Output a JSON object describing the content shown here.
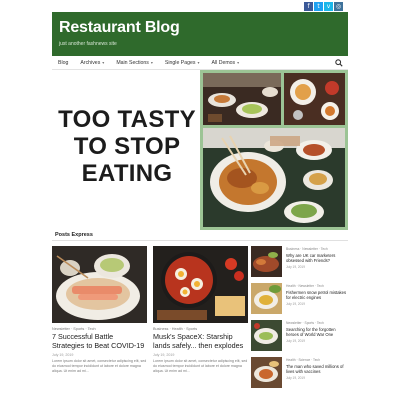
{
  "social": [
    {
      "icon": "facebook-icon",
      "glyph": "f"
    },
    {
      "icon": "twitter-icon",
      "glyph": "t"
    },
    {
      "icon": "vimeo-icon",
      "glyph": "v"
    },
    {
      "icon": "instagram-icon",
      "glyph": "◎"
    }
  ],
  "header": {
    "title": "Restaurant Blog",
    "tagline": "just another fashnews site",
    "color": "#2f6a2c"
  },
  "nav": {
    "items": [
      {
        "label": "Blog",
        "dropdown": false
      },
      {
        "label": "Archives",
        "dropdown": true
      },
      {
        "label": "Main Sections",
        "dropdown": true
      },
      {
        "label": "Single Pages",
        "dropdown": true
      },
      {
        "label": "All Demos",
        "dropdown": true
      }
    ],
    "caret": "▾"
  },
  "hero": {
    "line1": "TOO TASTY",
    "line2": "TO STOP",
    "line3": "EATING"
  },
  "posts_express": {
    "heading": "Posts Express",
    "cards": [
      {
        "meta": "Newsletter · Sports · Tech",
        "title": "7 Successful Battle Strategies to Beat COVID-19",
        "date": "July 19, 2019",
        "excerpt": "Lorem ipsum dolor sit amet, consectetur adipiscing elit, sed do eiusmod tempor incididunt ut labore et dolore magna aliqua. Ut enim ad mi..."
      },
      {
        "meta": "Business · Health · Sports",
        "title": "Musk's SpaceX: Starship lands safely... then explodes",
        "date": "July 19, 2019",
        "excerpt": "Lorem ipsum dolor sit amet, consectetur adipiscing elit, sed do eiusmod tempor incididunt ut labore et dolore magna aliqua. Ut enim ad mi..."
      }
    ],
    "side": [
      {
        "meta": "Business · Newsletter · Tech",
        "title": "Why are UK car marketers obsessed with Friends?",
        "date": "July 19, 2019"
      },
      {
        "meta": "Health · Newsletter · Tech",
        "title": "Fishermen snow petrol mistakes for electric engines",
        "date": "July 19, 2019"
      },
      {
        "meta": "Newsletter · Sports · Tech",
        "title": "Searching for the forgotten heroes of World War One",
        "date": "July 19, 2019"
      },
      {
        "meta": "Health · Science · Tech",
        "title": "The man who saved millions of lives with vaccines",
        "date": "July 19, 2019"
      }
    ]
  }
}
